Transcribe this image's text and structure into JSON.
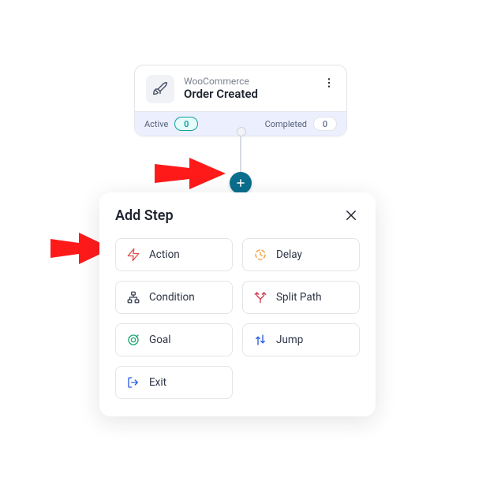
{
  "trigger": {
    "subtitle": "WooCommerce",
    "title": "Order Created",
    "active_label": "Active",
    "active_count": "0",
    "completed_label": "Completed",
    "completed_count": "0",
    "icon": "rocket-icon"
  },
  "panel": {
    "title": "Add Step",
    "options": [
      {
        "label": "Action",
        "icon": "bolt-icon",
        "color": "#e04f4a"
      },
      {
        "label": "Delay",
        "icon": "clock-icon",
        "color": "#f0a03c"
      },
      {
        "label": "Condition",
        "icon": "hierarchy-icon",
        "color": "#3a4256"
      },
      {
        "label": "Split Path",
        "icon": "split-icon",
        "color": "#d13c52"
      },
      {
        "label": "Goal",
        "icon": "target-icon",
        "color": "#1da673"
      },
      {
        "label": "Jump",
        "icon": "swap-icon",
        "color": "#2b5fe3"
      },
      {
        "label": "Exit",
        "icon": "exit-icon",
        "color": "#2b5fe3"
      }
    ]
  }
}
